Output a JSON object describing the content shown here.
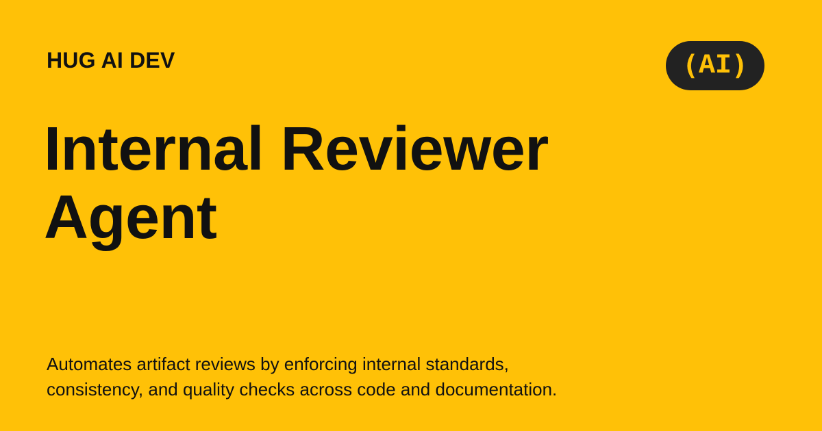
{
  "brand": {
    "name": "HUG AI DEV"
  },
  "badge": {
    "open": "(",
    "text": "AI",
    "close": ")",
    "background": "#222222",
    "foreground": "#FFC107"
  },
  "title": {
    "line1": "Internal Reviewer",
    "line2": "Agent"
  },
  "description": {
    "line1": "Automates artifact reviews by enforcing internal standards,",
    "line2": "consistency, and quality checks across code and documentation."
  },
  "colors": {
    "background": "#FFC107",
    "text": "#111111"
  }
}
